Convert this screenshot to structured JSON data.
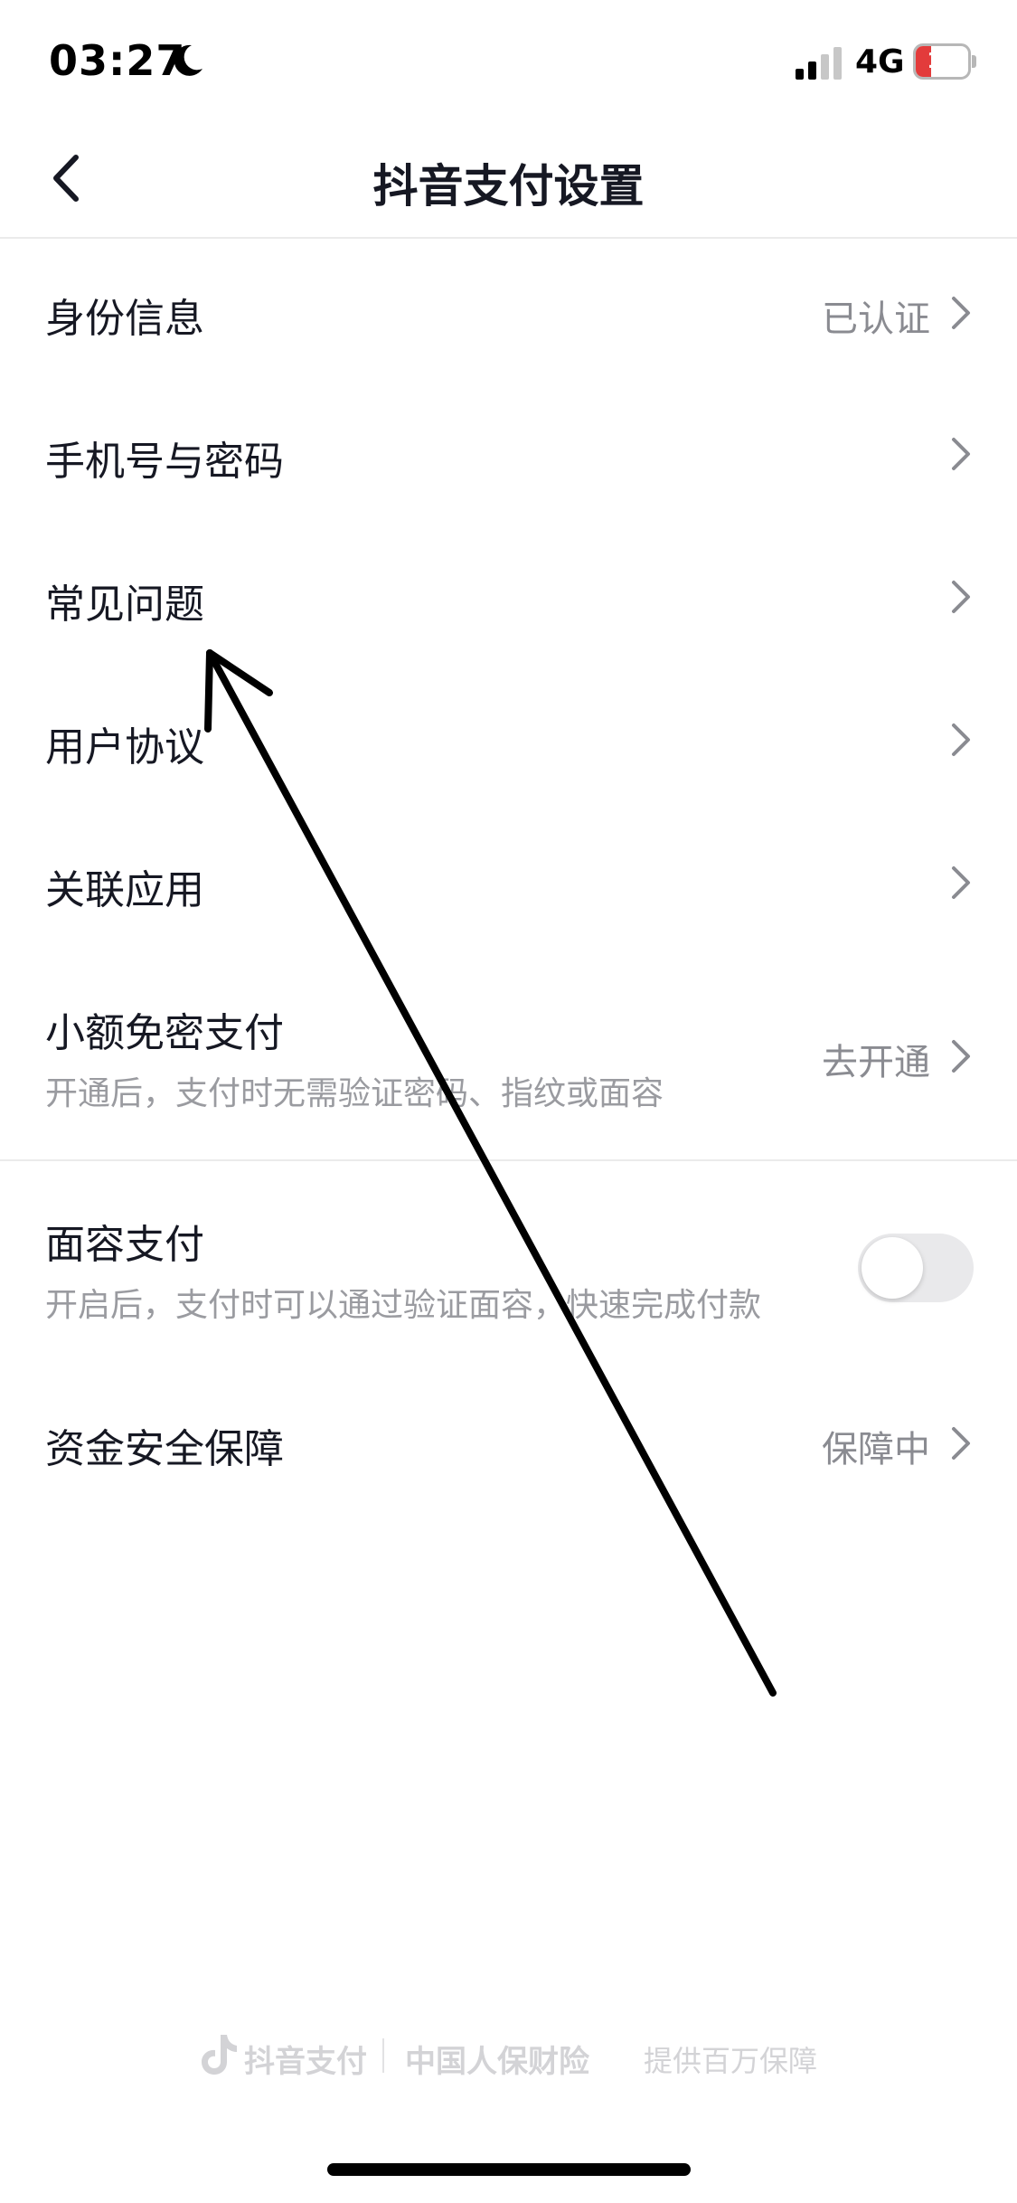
{
  "status_bar": {
    "time": "03:27",
    "network": "4G",
    "battery_level": "10",
    "battery_color": "#e33b3b",
    "icons": [
      "moon-icon",
      "signal-icon",
      "battery-icon"
    ]
  },
  "nav": {
    "title": "抖音支付设置",
    "back_icon": "chevron-left-icon"
  },
  "rows": {
    "identity": {
      "label": "身份信息",
      "value": "已认证"
    },
    "phone_password": {
      "label": "手机号与密码"
    },
    "faq": {
      "label": "常见问题"
    },
    "user_agreement": {
      "label": "用户协议"
    },
    "linked_apps": {
      "label": "关联应用"
    },
    "small_amount": {
      "label": "小额免密支付",
      "sub": "开通后，支付时无需验证密码、指纹或面容",
      "value": "去开通"
    },
    "face_pay": {
      "label": "面容支付",
      "sub": "开启后，支付时可以通过验证面容，快速完成付款",
      "enabled": false
    },
    "fund_security": {
      "label": "资金安全保障",
      "value": "保障中"
    }
  },
  "footer": {
    "brand": "抖音支付",
    "partner": "中国人保财险",
    "tagline": "提供百万保障"
  },
  "colors": {
    "text_primary": "#161823",
    "text_secondary": "#8a8b91",
    "toggle_off": "#e9e9eb",
    "annotation": "#000000"
  }
}
